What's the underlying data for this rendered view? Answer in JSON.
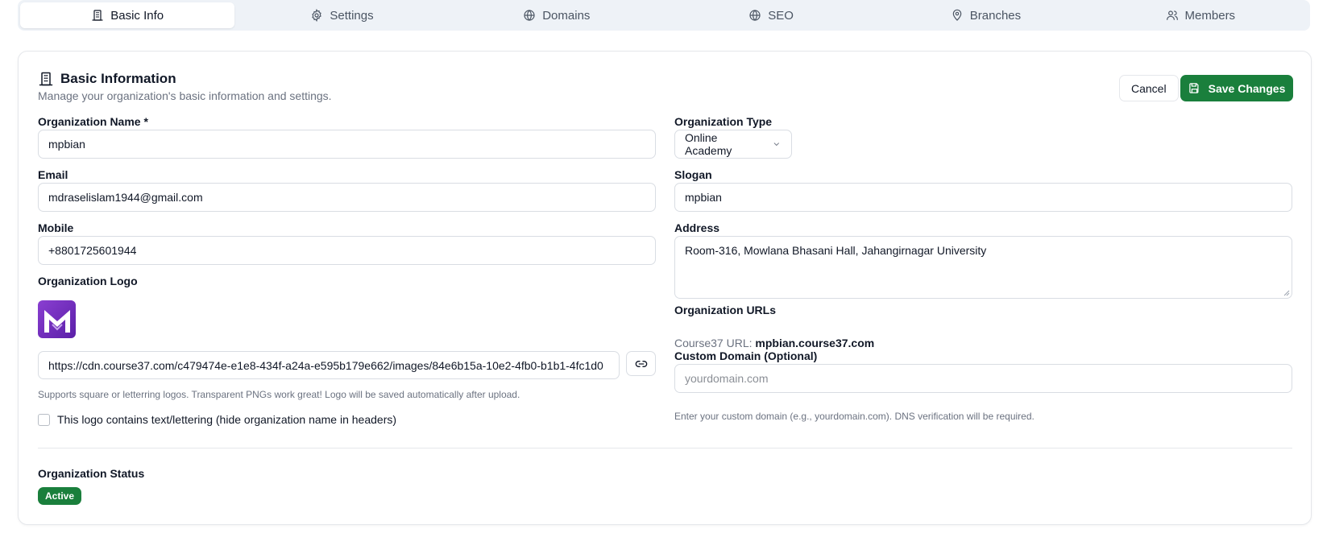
{
  "tabs": [
    {
      "label": "Basic Info",
      "icon": "building-icon",
      "active": true
    },
    {
      "label": "Settings",
      "icon": "gear-icon"
    },
    {
      "label": "Domains",
      "icon": "globe-icon"
    },
    {
      "label": "SEO",
      "icon": "globe-icon"
    },
    {
      "label": "Branches",
      "icon": "map-pin-icon"
    },
    {
      "label": "Members",
      "icon": "users-icon"
    }
  ],
  "card": {
    "title": "Basic Information",
    "description": "Manage your organization's basic information and settings.",
    "cancel_label": "Cancel",
    "save_label": "Save Changes"
  },
  "form": {
    "org_name_label": "Organization Name *",
    "org_name_value": "mpbian",
    "email_label": "Email",
    "email_value": "mdraselislam1944@gmail.com",
    "mobile_label": "Mobile",
    "mobile_value": "+8801725601944",
    "logo_label": "Organization Logo",
    "logo_url_value": "https://cdn.course37.com/c479474e-e1e8-434f-a24a-e595b179e662/images/84e6b15a-10e2-4fb0-b1b1-4fc1d0",
    "logo_hint": "Supports square or letterring logos. Transparent PNGs work great! Logo will be saved automatically after upload.",
    "logo_text_checkbox_label": "This logo contains text/lettering (hide organization name in headers)",
    "org_type_label": "Organization Type",
    "org_type_value": "Online Academy",
    "slogan_label": "Slogan",
    "slogan_value": "mpbian",
    "address_label": "Address",
    "address_value": "Room-316, Mowlana Bhasani Hall, Jahangirnagar University",
    "urls_label": "Organization URLs",
    "course37_url_prefix": "Course37 URL:",
    "course37_url_value": "mpbian.course37.com",
    "custom_domain_label": "Custom Domain (Optional)",
    "custom_domain_placeholder": "yourdomain.com",
    "custom_domain_hint": "Enter your custom domain (e.g., yourdomain.com). DNS verification will be required.",
    "status_label": "Organization Status",
    "status_value": "Active"
  },
  "colors": {
    "accent": "#1a7f3c",
    "tab_bg": "#eef2f7",
    "logo_purple": "#7b33c4"
  }
}
